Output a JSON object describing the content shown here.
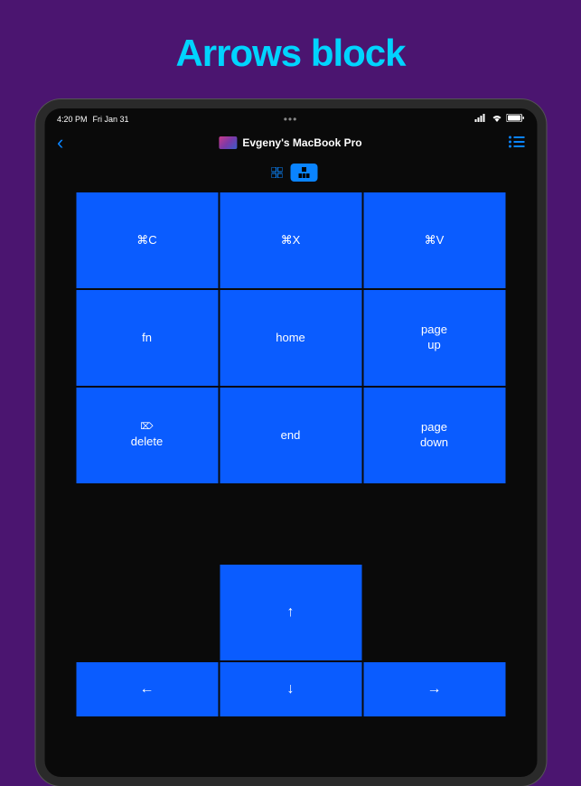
{
  "page": {
    "title": "Arrows block"
  },
  "status": {
    "time": "4:20 PM",
    "date": "Fri Jan 31",
    "ellipsis": "•••"
  },
  "nav": {
    "back": "‹",
    "title": "Evgeny's MacBook Pro",
    "menu": "☰"
  },
  "toggle": {
    "option1": "⊞",
    "option2": "⊟"
  },
  "keys": {
    "r1c1": "⌘C",
    "r1c2": "⌘X",
    "r1c3": "⌘V",
    "r2c1": "fn",
    "r2c2": "home",
    "r2c3_line1": "page",
    "r2c3_line2": "up",
    "r3c1_sym": "⌦",
    "r3c1": "delete",
    "r3c2": "end",
    "r3c3_line1": "page",
    "r3c3_line2": "down"
  },
  "arrows": {
    "up": "↑",
    "left": "←",
    "down": "↓",
    "right": "→"
  }
}
